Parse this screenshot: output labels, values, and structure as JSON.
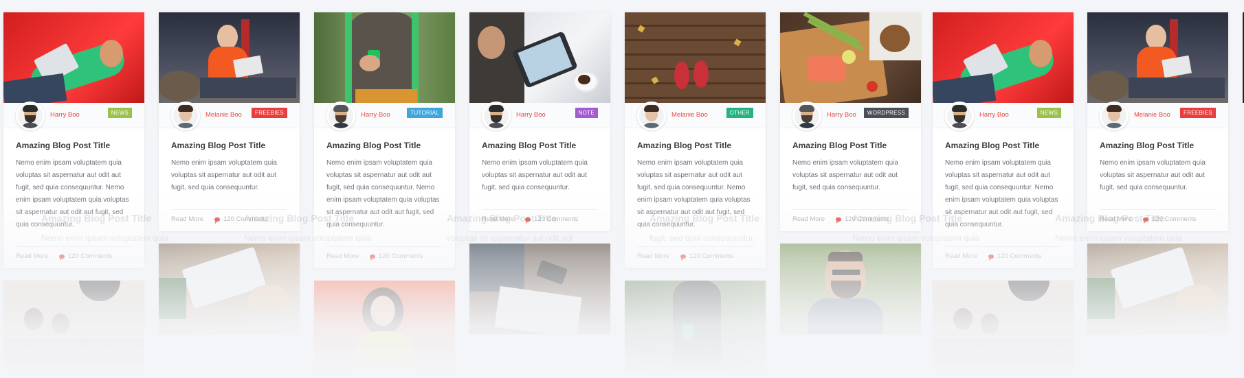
{
  "read_more": "Read More",
  "comments": "120 Comments",
  "post_title": "Amazing Blog Post Title",
  "excerpt_short": "Nemo enim ipsam voluptatem quia voluptas sit aspernatur aut odit aut fugit, sed quia consequuntur.",
  "excerpt_long": "Nemo enim ipsam voluptatem quia voluptas sit aspernatur aut odit aut fugit, sed quia consequuntur. Nemo enim ipsam voluptatem quia voluptas sit aspernatur aut odit aut fugit, sed quia consequuntur.",
  "ghost": {
    "title": "Amazing Blog Post Title",
    "text1": "Nemo enim ipsam voluptatem quia",
    "text2": "voluptas sit aspernatur aut odit aut",
    "text3": "fugit, sed quia consequuntur."
  },
  "posts": [
    {
      "author": "Harry Boo",
      "tag": "NEWS",
      "tag_color": "#9ac24a",
      "image": "man-on-red-couch-with-laptop"
    },
    {
      "author": "Melanie Boo",
      "tag": "FREEBIES",
      "tag_color": "#ea3d3d",
      "image": "woman-with-laptop"
    },
    {
      "author": "Harry Boo",
      "tag": "TUTORIAL",
      "tag_color": "#3ea6d8",
      "image": "man-with-phone"
    },
    {
      "author": "Harry Boo",
      "tag": "NOTE",
      "tag_color": "#a35bd0",
      "image": "tablet-and-coffee"
    },
    {
      "author": "Melanie Boo",
      "tag": "OTHER",
      "tag_color": "#21b47f",
      "image": "red-shoes-on-wood"
    },
    {
      "author": "Harry Boo",
      "tag": "WORDPRESS",
      "tag_color": "#4b4f55",
      "image": "salmon-and-asparagus"
    },
    {
      "author": "Harry Boo",
      "tag": "NEWS",
      "tag_color": "#9ac24a",
      "image": "man-on-red-couch-with-laptop"
    },
    {
      "author": "Melanie Boo",
      "tag": "FREEBIES",
      "tag_color": "#ea3d3d",
      "image": "woman-with-laptop"
    }
  ]
}
